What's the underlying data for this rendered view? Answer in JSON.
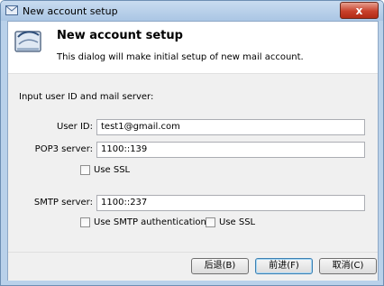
{
  "window": {
    "title": "New account setup",
    "close_glyph": "x"
  },
  "header": {
    "title": "New account setup",
    "subtitle": "This dialog will make initial setup of new mail account.",
    "icon": "mail-account-icon"
  },
  "form": {
    "instruction": "Input user ID and mail server:",
    "user_id_label": "User ID:",
    "user_id_value": "test1@gmail.com",
    "pop3_label": "POP3 server:",
    "pop3_value": "1100::139",
    "pop3_ssl_label": "Use SSL",
    "pop3_ssl_checked": false,
    "smtp_label": "SMTP server:",
    "smtp_value": "1100::237",
    "smtp_auth_label": "Use SMTP authentication",
    "smtp_auth_checked": false,
    "smtp_ssl_label": "Use SSL",
    "smtp_ssl_checked": false
  },
  "buttons": {
    "back": "后退(B)",
    "next": "前进(F)",
    "cancel": "取消(C)"
  },
  "colors": {
    "titlebar": "#aac6e4",
    "close_button": "#c8412b",
    "body_bg": "#f0f0f0"
  }
}
